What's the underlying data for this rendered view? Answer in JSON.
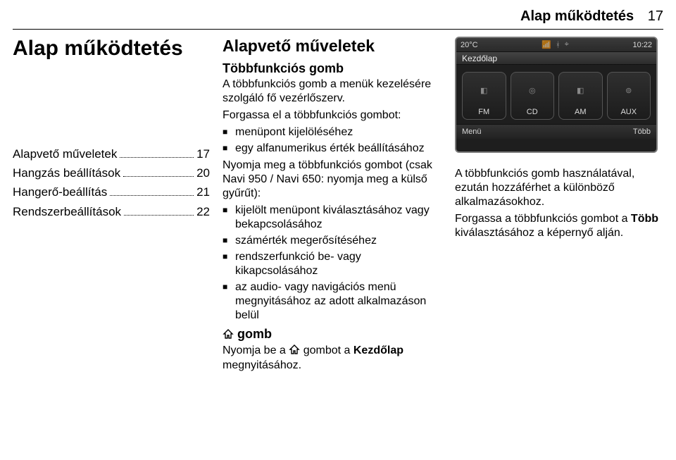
{
  "header": {
    "running_title": "Alap működtetés",
    "running_page": "17"
  },
  "col1": {
    "chapter_title": "Alap működtetés",
    "toc": [
      {
        "label": "Alapvető műveletek",
        "page": "17"
      },
      {
        "label": "Hangzás beállítások",
        "page": "20"
      },
      {
        "label": "Hangerő-beállítás",
        "page": "21"
      },
      {
        "label": "Rendszerbeállítások",
        "page": "22"
      }
    ]
  },
  "col2": {
    "h2": "Alapvető műveletek",
    "h3a": "Többfunkciós gomb",
    "p1": "A többfunkciós gomb a menük kezelésére szolgáló fő vezérlőszerv.",
    "p2": "Forgassa el a többfunkciós gombot:",
    "list1": [
      "menüpont kijelöléséhez",
      "egy alfanumerikus érték beállításához"
    ],
    "p3": "Nyomja meg a többfunkciós gombot (csak Navi 950 / Navi 650: nyomja meg a külső gyűrűt):",
    "list2": [
      "kijelölt menüpont kiválasztásához vagy bekapcsolásához",
      "számérték megerősítéséhez",
      "rendszerfunkció be- vagy kikapcsolásához",
      "az audio- vagy navigációs menü megnyitásához az adott alkalmazáson belül"
    ],
    "h3b_suffix": "gomb",
    "p4_pre": "Nyomja be a ",
    "p4_mid": " gombot a ",
    "p4_bold": "Kezdőlap",
    "p4_end": " megnyitásához."
  },
  "col3": {
    "screen": {
      "temp": "20°C",
      "time": "10:22",
      "title": "Kezdőlap",
      "tiles": [
        "FM",
        "CD",
        "AM",
        "AUX"
      ],
      "bottom_left": "Menü",
      "bottom_right": "Több"
    },
    "p1": "A többfunkciós gomb használatával, ezután hozzáférhet a különböző alkalmazásokhoz.",
    "p2_pre": "Forgassa a többfunkciós gombot a ",
    "p2_bold": "Több",
    "p2_end": " kiválasztásához a képernyő alján."
  }
}
